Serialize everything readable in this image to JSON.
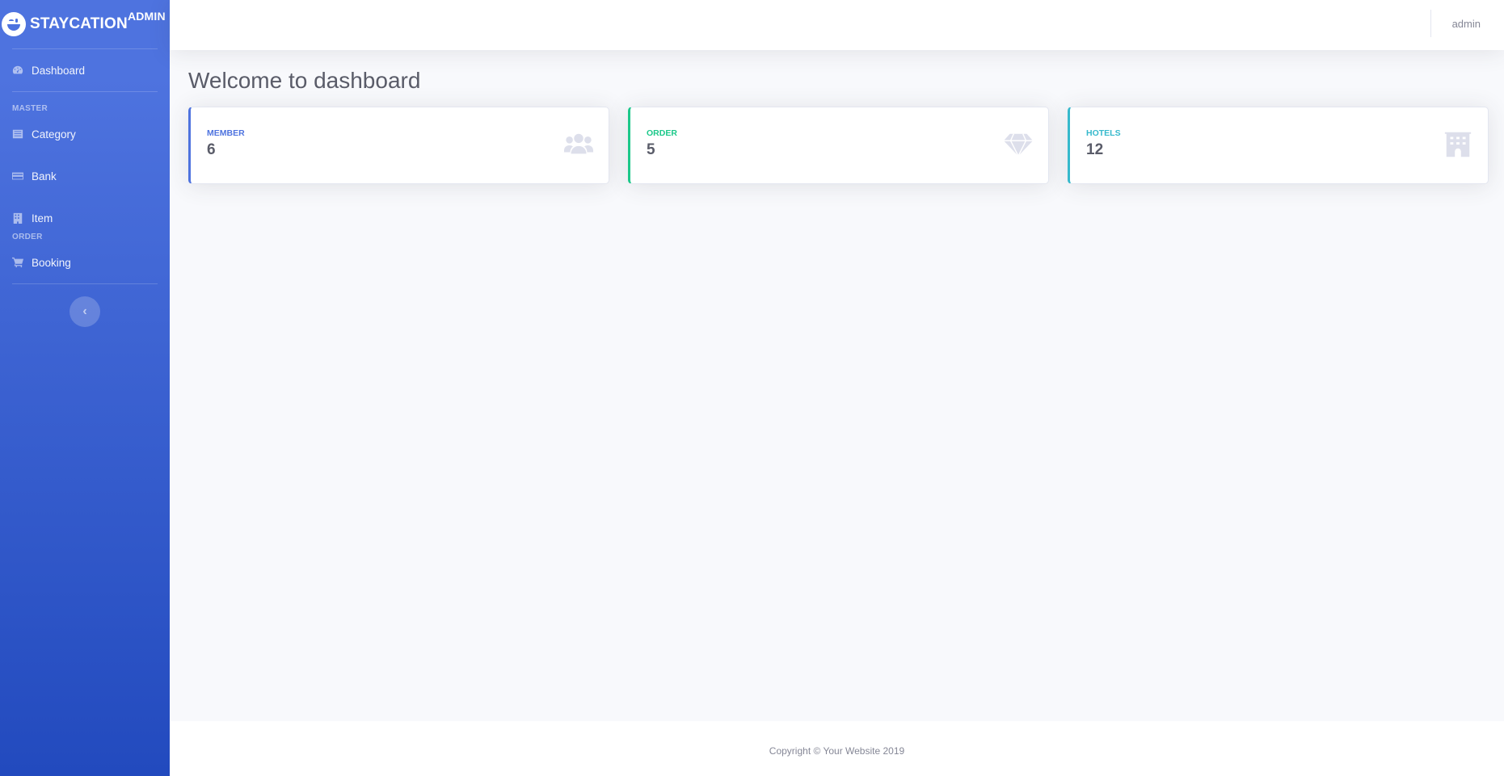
{
  "brand": {
    "name": "Staycation",
    "suffix": "Admin"
  },
  "sidebar": {
    "dashboard": {
      "label": "Dashboard",
      "icon": "dashboard-gauge-icon"
    },
    "heading_master": "Master",
    "items_master": [
      {
        "label": "Category",
        "icon": "list-icon"
      },
      {
        "label": "Bank",
        "icon": "credit-card-icon"
      },
      {
        "label": "Item",
        "icon": "building-icon"
      }
    ],
    "heading_order": "Order",
    "items_order": [
      {
        "label": "Booking",
        "icon": "cart-icon"
      }
    ],
    "toggle_glyph": "‹"
  },
  "topbar": {
    "user": "admin"
  },
  "main": {
    "title": "Welcome to dashboard",
    "cards": [
      {
        "label": "Member",
        "value": "6",
        "icon": "users-icon",
        "accent": "#4e73df"
      },
      {
        "label": "Order",
        "value": "5",
        "icon": "gem-icon",
        "accent": "#1cc88a"
      },
      {
        "label": "Hotels",
        "value": "12",
        "icon": "hotel-building-icon",
        "accent": "#36b9cc"
      }
    ]
  },
  "footer": {
    "copyright": "Copyright © Your Website 2019"
  }
}
